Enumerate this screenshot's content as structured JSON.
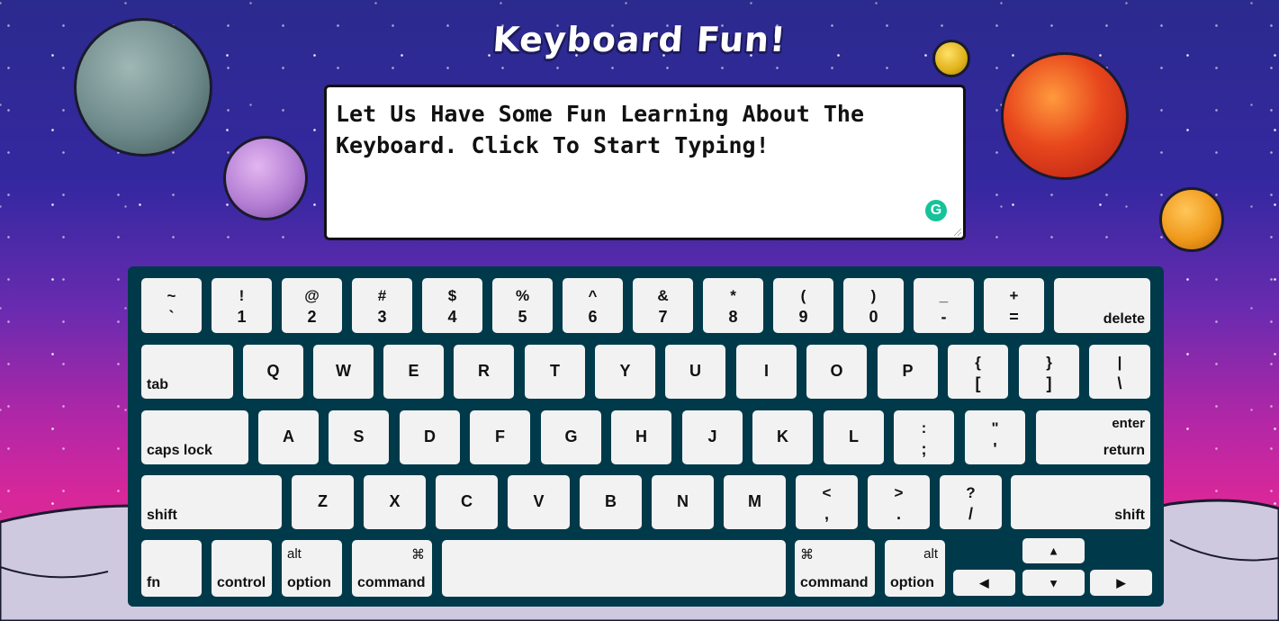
{
  "title": "Keyboard Fun!",
  "textarea": {
    "text": "Let Us Have Some Fun Learning About The Keyboard. Click To Start Typing!"
  },
  "icons": {
    "grammarly": "grammarly-icon",
    "resize": "resize-handle-icon"
  },
  "colors": {
    "keyboard_bg": "#003a4a",
    "key_bg": "#f2f2f2",
    "grammarly": "#15c39a"
  },
  "keys": {
    "row1": [
      {
        "top": "~",
        "bot": "`"
      },
      {
        "top": "!",
        "bot": "1"
      },
      {
        "top": "@",
        "bot": "2"
      },
      {
        "top": "#",
        "bot": "3"
      },
      {
        "top": "$",
        "bot": "4"
      },
      {
        "top": "%",
        "bot": "5"
      },
      {
        "top": "^",
        "bot": "6"
      },
      {
        "top": "&",
        "bot": "7"
      },
      {
        "top": "*",
        "bot": "8"
      },
      {
        "top": "(",
        "bot": "9"
      },
      {
        "top": ")",
        "bot": "0"
      },
      {
        "top": "_",
        "bot": "-"
      },
      {
        "top": "+",
        "bot": "="
      }
    ],
    "delete": "delete",
    "tab": "tab",
    "row2": [
      "Q",
      "W",
      "E",
      "R",
      "T",
      "Y",
      "U",
      "I",
      "O",
      "P"
    ],
    "row2_sym": [
      {
        "top": "{",
        "bot": "["
      },
      {
        "top": "}",
        "bot": "]"
      },
      {
        "top": "|",
        "bot": "\\"
      }
    ],
    "caps_lock": "caps lock",
    "row3": [
      "A",
      "S",
      "D",
      "F",
      "G",
      "H",
      "J",
      "K",
      "L"
    ],
    "row3_sym": [
      {
        "top": ":",
        "bot": ";"
      },
      {
        "top": "\"",
        "bot": "'"
      }
    ],
    "enter": "enter",
    "return": "return",
    "shift_left": "shift",
    "row4": [
      "Z",
      "X",
      "C",
      "V",
      "B",
      "N",
      "M"
    ],
    "row4_sym": [
      {
        "top": "<",
        "bot": ","
      },
      {
        "top": ">",
        "bot": "."
      },
      {
        "top": "?",
        "bot": "/"
      }
    ],
    "shift_right": "shift",
    "fn": "fn",
    "control": "control",
    "alt": "alt",
    "option": "option",
    "cmd_symbol": "⌘",
    "command": "command",
    "arrow_up": "▲",
    "arrow_left": "◀",
    "arrow_down": "▼",
    "arrow_right": "▶"
  }
}
